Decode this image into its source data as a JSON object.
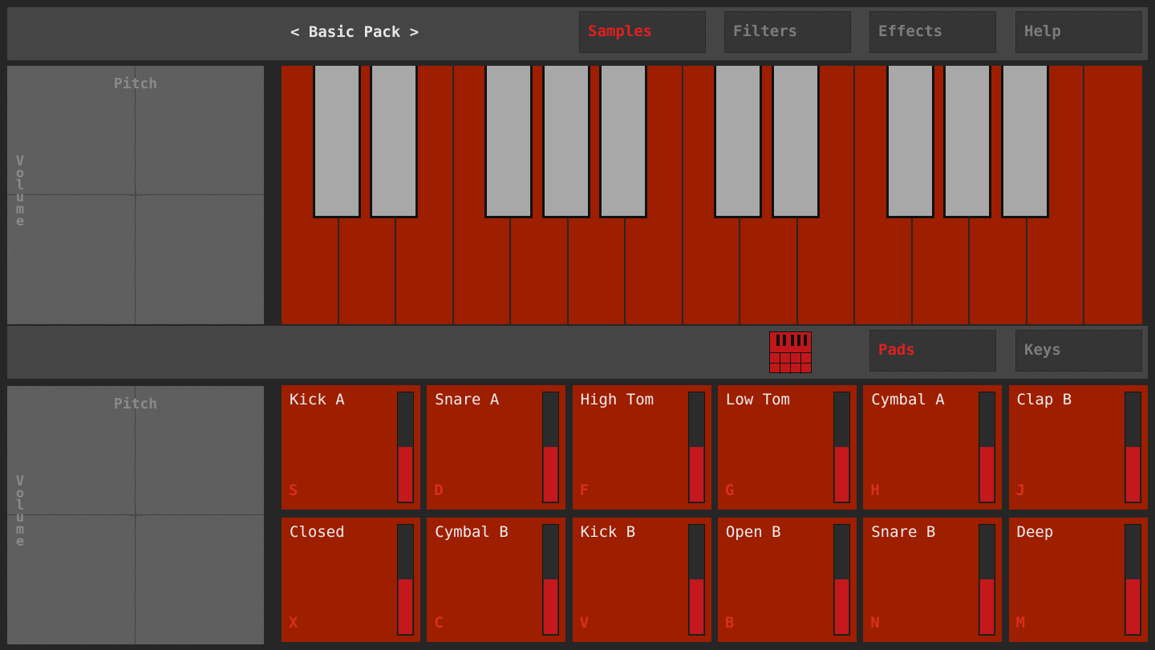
{
  "header": {
    "pack_prev": "<",
    "pack_name": "Basic Pack",
    "pack_next": ">",
    "tabs": [
      {
        "label": "Samples",
        "active": true
      },
      {
        "label": "Filters",
        "active": false
      },
      {
        "label": "Effects",
        "active": false
      },
      {
        "label": "Help",
        "active": false
      }
    ]
  },
  "xy_pads": [
    {
      "x_label": "Pitch",
      "y_label": "Volume"
    },
    {
      "x_label": "Pitch",
      "y_label": "Volume"
    }
  ],
  "keyboard": {
    "white_keys": 15,
    "black_keys": 10
  },
  "view_switch": {
    "icon": "pads-grid-icon",
    "buttons": [
      {
        "label": "Pads",
        "active": true
      },
      {
        "label": "Keys",
        "active": false
      }
    ]
  },
  "pads": [
    {
      "label": "Kick A",
      "key": "S",
      "level": 0.5
    },
    {
      "label": "Snare A",
      "key": "D",
      "level": 0.5
    },
    {
      "label": "High Tom",
      "key": "F",
      "level": 0.5
    },
    {
      "label": "Low Tom",
      "key": "G",
      "level": 0.5
    },
    {
      "label": "Cymbal A",
      "key": "H",
      "level": 0.5
    },
    {
      "label": "Clap B",
      "key": "J",
      "level": 0.5
    },
    {
      "label": "Closed",
      "key": "X",
      "level": 0.5
    },
    {
      "label": "Cymbal B",
      "key": "C",
      "level": 0.5
    },
    {
      "label": "Kick B",
      "key": "V",
      "level": 0.5
    },
    {
      "label": "Open B",
      "key": "B",
      "level": 0.5
    },
    {
      "label": "Snare B",
      "key": "N",
      "level": 0.5
    },
    {
      "label": "Deep",
      "key": "M",
      "level": 0.5
    }
  ],
  "colors": {
    "accent": "#e02020",
    "key_red": "#9e1e00",
    "black_key": "#a8a8a8",
    "panel": "#454545",
    "background": "#262626"
  }
}
